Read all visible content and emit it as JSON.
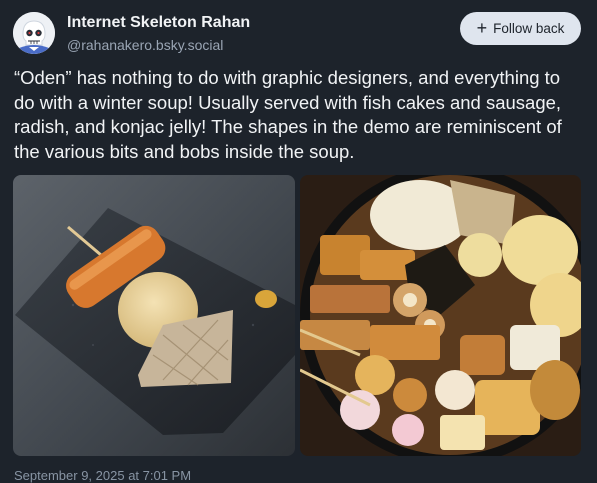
{
  "author": {
    "display_name": "Internet Skeleton Rahan",
    "handle": "@rahanakero.bsky.social",
    "avatar_icon": "skeleton-avatar"
  },
  "follow_button": {
    "label": "Follow back",
    "icon": "plus-icon"
  },
  "post": {
    "text": "“Oden” has nothing to do with graphic designers, and everything to do with a winter soup! Usually served with fish cakes and sausage, radish, and konjac jelly! The shapes in the demo are reminiscent of the various bits and bobs inside the soup.",
    "images": [
      {
        "subject": "oden skewer, radish and konjac on a dark plate"
      },
      {
        "subject": "pot of oden soup with fish cakes, eggs and tofu"
      }
    ],
    "timestamp": "September 9, 2025 at 7:01 PM"
  },
  "colors": {
    "background": "#1d232b",
    "button_bg": "#dfe5ee",
    "muted_text": "#9aa5b4"
  }
}
